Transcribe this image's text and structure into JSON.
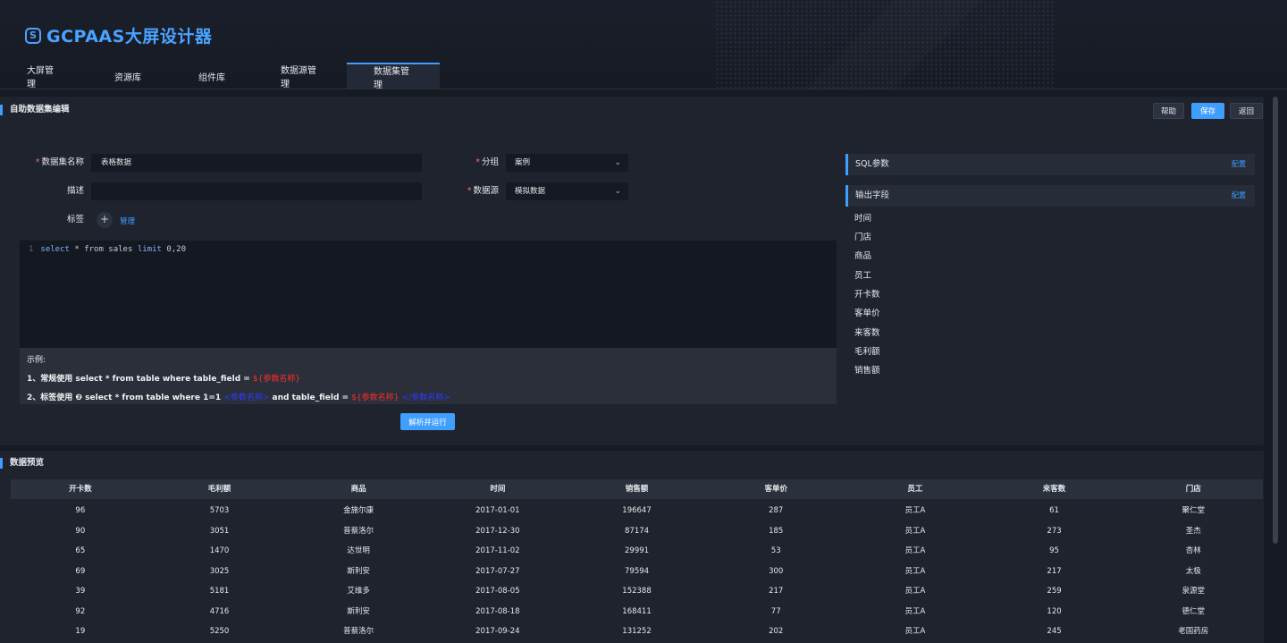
{
  "app": {
    "logo_text": "GCPAAS大屏设计器",
    "logo_icon": "S"
  },
  "nav": [
    {
      "label": "大屏管理"
    },
    {
      "label": "资源库"
    },
    {
      "label": "组件库"
    },
    {
      "label": "数据源管理"
    },
    {
      "label": "数据集管理",
      "active": true
    }
  ],
  "editor": {
    "title": "自助数据集编辑",
    "buttons": {
      "help": "帮助",
      "save": "保存",
      "back": "返回"
    },
    "form": {
      "name_label": "数据集名称",
      "name_value": "表格数据",
      "group_label": "分组",
      "group_value": "案例",
      "desc_label": "描述",
      "desc_value": "",
      "source_label": "数据源",
      "source_value": "模拟数据",
      "tag_label": "标签",
      "tag_add": "+",
      "tag_manage": "管理"
    },
    "code": {
      "line_no": "1",
      "kw1": "select",
      "mid1": "* from",
      "mid2": "sales",
      "kw2": "limit",
      "tail": "0,20"
    },
    "example": {
      "title": "示例:",
      "line1_prefix": "1、常规使用 select * from table where table_field =",
      "line1_param": "${参数名称}",
      "line2_prefix": "2、标签使用 ❷ select * from table where 1=1",
      "line2_tag1": "<参数名称>",
      "line2_mid": "and table_field =",
      "line2_param": "${参数名称}",
      "line2_tag2": "</参数名称>"
    },
    "run_button": "解析并运行",
    "sql_params": {
      "title": "SQL参数",
      "config": "配置"
    },
    "output_fields": {
      "title": "输出字段",
      "config": "配置",
      "items": [
        "时间",
        "门店",
        "商品",
        "员工",
        "开卡数",
        "客单价",
        "来客数",
        "毛利额",
        "销售额"
      ]
    }
  },
  "preview": {
    "title": "数据预览",
    "columns": [
      "开卡数",
      "毛利额",
      "商品",
      "时间",
      "销售额",
      "客单价",
      "员工",
      "来客数",
      "门店"
    ],
    "rows": [
      [
        "96",
        "5703",
        "金施尔康",
        "2017-01-01",
        "196647",
        "287",
        "员工A",
        "61",
        "聚仁堂"
      ],
      [
        "90",
        "3051",
        "普蔡洛尔",
        "2017-12-30",
        "87174",
        "185",
        "员工A",
        "273",
        "圣杰"
      ],
      [
        "65",
        "1470",
        "达世明",
        "2017-11-02",
        "29991",
        "53",
        "员工A",
        "95",
        "杏林"
      ],
      [
        "69",
        "3025",
        "斯利安",
        "2017-07-27",
        "79594",
        "300",
        "员工A",
        "217",
        "太极"
      ],
      [
        "39",
        "5181",
        "艾维多",
        "2017-08-05",
        "152388",
        "217",
        "员工A",
        "259",
        "泉源堂"
      ],
      [
        "92",
        "4716",
        "斯利安",
        "2017-08-18",
        "168411",
        "77",
        "员工A",
        "120",
        "德仁堂"
      ],
      [
        "19",
        "5250",
        "普蔡洛尔",
        "2017-09-24",
        "131252",
        "202",
        "员工A",
        "245",
        "老国药房"
      ]
    ]
  },
  "colors": {
    "accent": "#409eff",
    "required": "#f56c6c",
    "example_red": "#ff2d2d",
    "example_blue": "#2f3cff"
  }
}
